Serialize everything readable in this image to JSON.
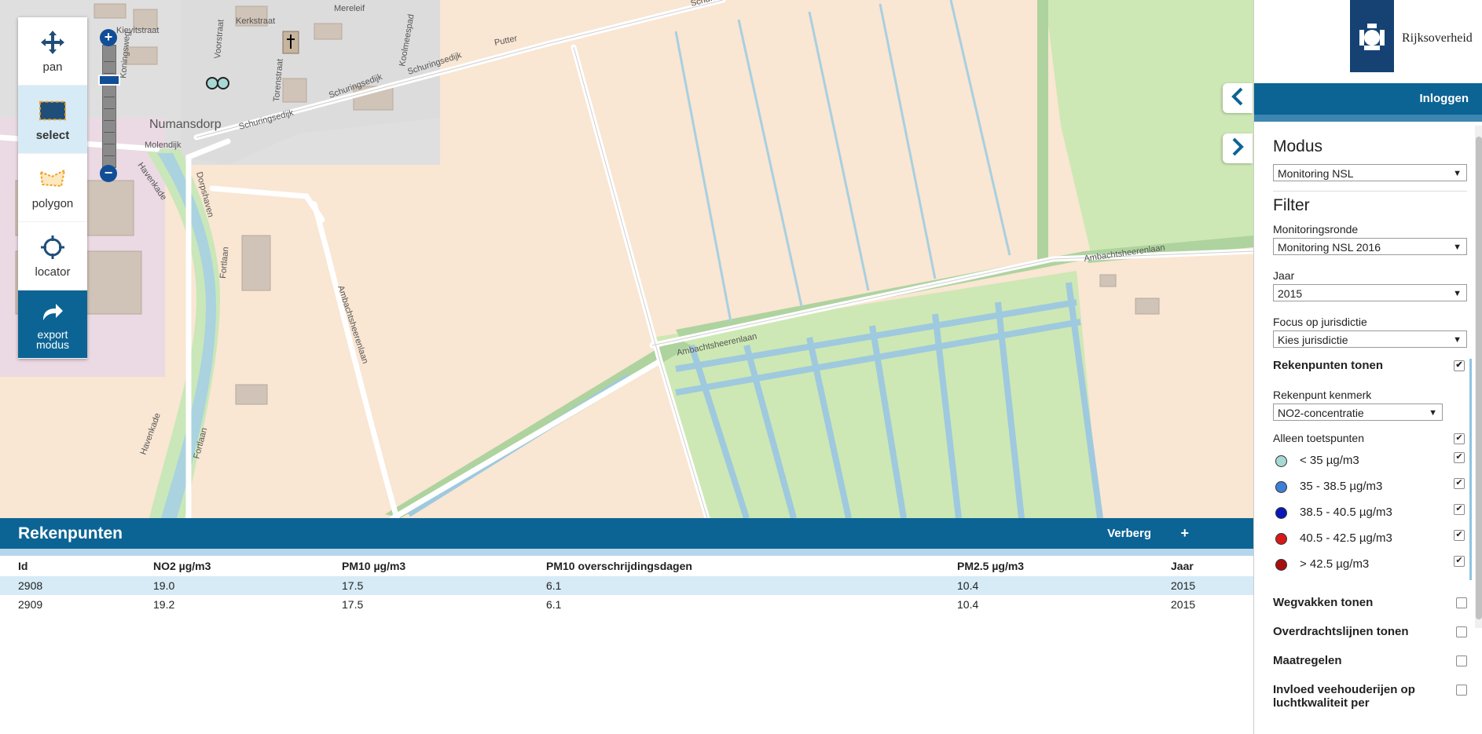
{
  "tools": [
    {
      "label": "pan",
      "icon": "pan-icon"
    },
    {
      "label": "select",
      "icon": "select-rectangle-icon"
    },
    {
      "label": "polygon",
      "icon": "polygon-icon"
    },
    {
      "label": "locator",
      "icon": "locator-crosshair-icon"
    },
    {
      "label": "export modus",
      "icon": "export-arrow-icon"
    }
  ],
  "zoom": {
    "in": "+",
    "out": "−"
  },
  "map": {
    "streets": {
      "kievitstraat": "Kievitstraat",
      "kerkstraat": "Kerkstraat",
      "voorstraat": "Voorstraat",
      "mereleif": "Mereleif",
      "putter": "Putter",
      "schuringsedijk": "Schuringsedijk",
      "numansdorp": "Numansdorp",
      "molendijk": "Molendijk",
      "havenkade": "Havenkade",
      "dorpshaven": "Dorpshaven",
      "fortlaan": "Fortlaan",
      "ambachtsheerenlaan": "Ambachtsheerenlaan",
      "koolmeespad": "Koolmeespad",
      "torenstraat": "Torenstraat",
      "koningsweg": "Koningsweg",
      "schuring": "Schuring"
    }
  },
  "sidebar": {
    "logo_text": "Rijksoverheid",
    "login": "Inloggen",
    "modus_title": "Modus",
    "modus_value": "Monitoring NSL",
    "filter_title": "Filter",
    "ronde_label": "Monitoringsronde",
    "ronde_value": "Monitoring NSL 2016",
    "jaar_label": "Jaar",
    "jaar_value": "2015",
    "focus_label": "Focus op jurisdictie",
    "focus_value": "Kies jurisdictie",
    "rekenpunten_tonen": "Rekenpunten tonen",
    "kenmerk_label": "Rekenpunt kenmerk",
    "kenmerk_value": "NO2-concentratie",
    "alleen_toets": "Alleen toetspunten",
    "legend": [
      {
        "label": "< 35 µg/m3",
        "color": "#a8d8d4"
      },
      {
        "label": "35 - 38.5 µg/m3",
        "color": "#3e7fd6"
      },
      {
        "label": "38.5 - 40.5 µg/m3",
        "color": "#0a19b5"
      },
      {
        "label": "40.5 - 42.5 µg/m3",
        "color": "#d61818"
      },
      {
        "label": "> 42.5 µg/m3",
        "color": "#a70f0f"
      }
    ],
    "wegvakken": "Wegvakken tonen",
    "overdracht": "Overdrachtslijnen tonen",
    "maatregelen": "Maatregelen",
    "invloed": "Invloed veehouderijen op luchtkwaliteit per"
  },
  "bottom": {
    "title": "Rekenpunten",
    "hide": "Verberg",
    "plus": "+",
    "columns": [
      "Id",
      "NO2 µg/m3",
      "PM10 µg/m3",
      "PM10 overschrijdingsdagen",
      "PM2.5 µg/m3",
      "Jaar"
    ],
    "rows": [
      [
        "2908",
        "19.0",
        "17.5",
        "6.1",
        "10.4",
        "2015"
      ],
      [
        "2909",
        "19.2",
        "17.5",
        "6.1",
        "10.4",
        "2015"
      ]
    ]
  }
}
